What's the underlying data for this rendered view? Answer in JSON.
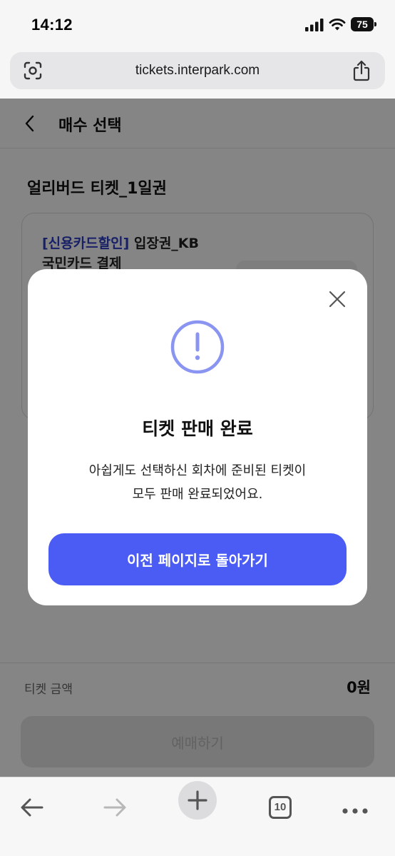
{
  "status_bar": {
    "time": "14:12",
    "battery_level": "75"
  },
  "browser": {
    "url": "tickets.interpark.com",
    "tab_count": "10"
  },
  "page": {
    "title": "매수 선택",
    "ticket_section_title": "얼리버드 티켓_1일권",
    "ticket": {
      "discount_tag": "[신용카드할인]",
      "name_rest": " 입장권_KB",
      "name_line2": "국민카드 결제"
    },
    "price_label": "티켓 금액",
    "price_value": "0원",
    "book_button_label": "예매하기"
  },
  "modal": {
    "title": "티켓 판매 완료",
    "message_line1": "아쉽게도 선택하신 회차에 준비된 티켓이",
    "message_line2": "모두 판매 완료되었어요.",
    "button_label": "이전 페이지로 돌아가기",
    "accent_color": "#4a5cf4",
    "icon_color": "#8a95f2"
  }
}
